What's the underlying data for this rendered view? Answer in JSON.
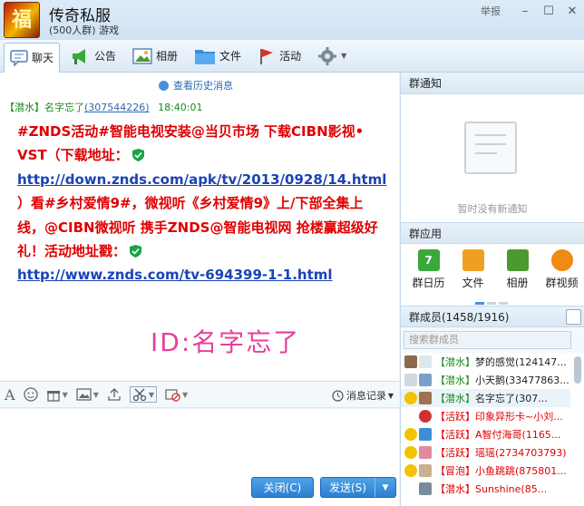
{
  "window": {
    "logo_char": "福",
    "group_name": "传奇私服",
    "group_sub": "(500人群) 游戏",
    "report_label": "举报",
    "btn_min": "–",
    "btn_max": "☐",
    "btn_close": "✕"
  },
  "toolbar": {
    "tabs": [
      {
        "label": "聊天",
        "icon": "chat-bubble-icon"
      },
      {
        "label": "公告",
        "icon": "megaphone-icon"
      },
      {
        "label": "相册",
        "icon": "photo-album-icon"
      },
      {
        "label": "文件",
        "icon": "folder-icon"
      },
      {
        "label": "活动",
        "icon": "flag-icon"
      }
    ],
    "settings_icon": "gear-icon"
  },
  "chat": {
    "history_link": "查看历史消息",
    "message": {
      "title_tag": "【潜水】",
      "sender": "名字忘了",
      "qq": "(307544226)",
      "time": "18:40:01",
      "line1": "#ZNDS活动#智能电视安装@当贝市场 下载CIBN影视•",
      "line2": "VST（下载地址：",
      "link1": "http://down.znds.com/apk/tv/2013/0928/14.html",
      "line4": "）看#乡村爱情9#，微视听《乡村爱情9》上/下部全集上",
      "line5": "线，@CIBN微视听 携手ZNDS@智能电视网 抢楼赢超级好",
      "line6": "礼！活动地址戳：",
      "link2": "http://www.znds.com/tv-694399-1-1.html",
      "signature": "ID:名字忘了"
    },
    "input_toolbar": {
      "icons": [
        "font-icon",
        "emoji-icon",
        "gift-icon",
        "image-icon",
        "upload-icon",
        "screenshot-icon",
        "block-icon"
      ],
      "record_label": "消息记录"
    },
    "buttons": {
      "close": "关闭(C)",
      "send": "发送(S)"
    }
  },
  "right_panel": {
    "notice_header": "群通知",
    "notice_empty": "暂时没有新通知",
    "apps_header": "群应用",
    "apps": [
      {
        "label": "群日历",
        "color": "#3aa83a"
      },
      {
        "label": "文件",
        "color": "#f0a020"
      },
      {
        "label": "相册",
        "color": "#4a9a30"
      },
      {
        "label": "群视频",
        "color": "#f08a10"
      }
    ],
    "members_header": "群成员(1458/1916)",
    "search_placeholder": "搜索群成员",
    "members": [
      {
        "tag": "【潜水】",
        "name": "梦的感觉(124147...",
        "tag_color": "#1a8a1a"
      },
      {
        "tag": "【潜水】",
        "name": "小天鹅(33477863...",
        "tag_color": "#1a8a1a"
      },
      {
        "tag": "【潜水】",
        "name": "名字忘了(307...",
        "tag_color": "#1a8a1a"
      },
      {
        "tag": "【活跃】",
        "name": "印象异形卡~小刘...",
        "tag_color": "#e00000"
      },
      {
        "tag": "【活跃】",
        "name": "A智付海哥(1165...",
        "tag_color": "#e00000"
      },
      {
        "tag": "【活跃】",
        "name": "瑶瑶(2734703793)",
        "tag_color": "#e00000"
      },
      {
        "tag": "【冒泡】",
        "name": "小鱼跳跳(875801...",
        "tag_color": "#e00000"
      },
      {
        "tag": "【潜水】",
        "name": "Sunshine(85...",
        "tag_color": "#1a8a1a"
      }
    ]
  }
}
